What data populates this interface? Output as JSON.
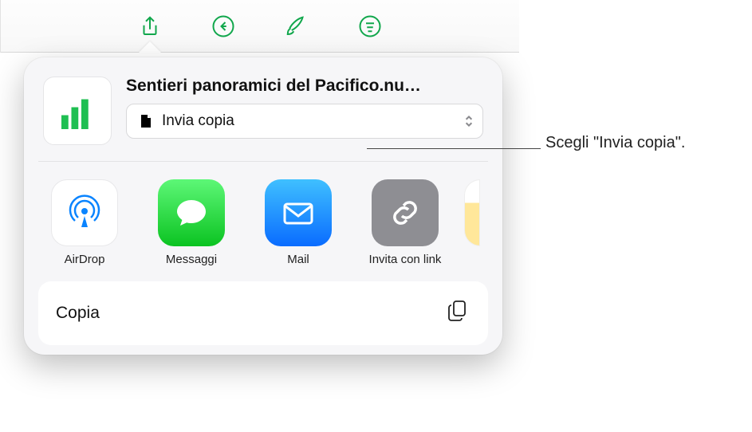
{
  "toolbar": {
    "buttons": [
      "share",
      "reply",
      "brush",
      "more"
    ],
    "active": 0
  },
  "document": {
    "title": "Sentieri panoramici del Pacifico.nu…"
  },
  "select": {
    "label": "Invia copia"
  },
  "apps": [
    {
      "id": "airdrop",
      "label": "AirDrop",
      "kind": "airdrop"
    },
    {
      "id": "messages",
      "label": "Messaggi",
      "kind": "messages"
    },
    {
      "id": "mail",
      "label": "Mail",
      "kind": "mail"
    },
    {
      "id": "link",
      "label": "Invita con link",
      "kind": "link"
    },
    {
      "id": "notes",
      "label": "",
      "kind": "notes"
    }
  ],
  "actions": {
    "copy": "Copia"
  },
  "callout": {
    "text": "Scegli \"Invia copia\"."
  }
}
